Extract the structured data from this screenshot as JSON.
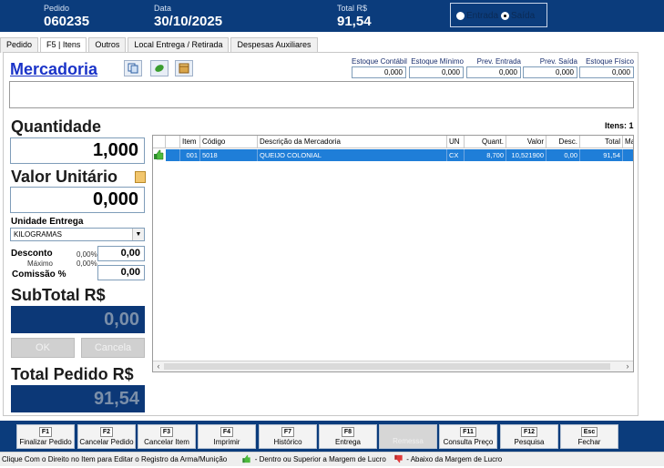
{
  "header": {
    "pedido_label": "Pedido",
    "pedido_value": "060235",
    "data_label": "Data",
    "data_value": "30/10/2025",
    "total_label": "Total R$",
    "total_value": "91,54",
    "entrada_label": "Entrada",
    "saida_label": "Saída",
    "selected": "Saída"
  },
  "tabs": [
    "Pedido",
    "F5 | Itens",
    "Outros",
    "Local Entrega  / Retirada",
    "Despesas Auxiliares"
  ],
  "active_tab": "F5 | Itens",
  "mercadoria": {
    "title": "Mercadoria",
    "icons": [
      "copy-icon",
      "leaf-icon",
      "box-icon"
    ]
  },
  "stock": [
    {
      "label": "Estoque Contábil",
      "value": "0,000"
    },
    {
      "label": "Estoque Mínimo",
      "value": "0,000"
    },
    {
      "label": "Prev. Entrada",
      "value": "0,000"
    },
    {
      "label": "Prev. Saída",
      "value": "0,000"
    },
    {
      "label": "Estoque Físico",
      "value": "0,000"
    }
  ],
  "form": {
    "quantidade_label": "Quantidade",
    "quantidade_value": "1,000",
    "valor_unitario_label": "Valor Unitário",
    "valor_unitario_value": "0,000",
    "unidade_entrega_label": "Unidade Entrega",
    "unidade_entrega_value": "KILOGRAMAS",
    "desconto_label": "Desconto",
    "desconto_pct": "0,00%",
    "desconto_value": "0,00",
    "maximo_label": "Máximo",
    "maximo_pct": "0,00%",
    "comissao_label": "Comissão %",
    "comissao_value": "0,00",
    "subtotal_label": "SubTotal R$",
    "subtotal_value": "0,00",
    "ok_label": "OK",
    "cancela_label": "Cancela",
    "total_pedido_label": "Total Pedido R$",
    "total_pedido_value": "91,54"
  },
  "grid": {
    "items_count": "Itens: 1",
    "columns": [
      "Item",
      "Código",
      "Descrição da Mercadoria",
      "UN",
      "Quant.",
      "Valor",
      "Desc.",
      "Total",
      "Ma"
    ],
    "rows": [
      {
        "item": "001",
        "codigo": "5018",
        "descricao": "QUEIJO COLONIAL",
        "un": "CX",
        "quant": "8,700",
        "valor": "10,521900",
        "desc": "0,00",
        "total": "91,54",
        "ma": ""
      }
    ],
    "row_status_icon": "thumbs-up-icon"
  },
  "footer": [
    {
      "key": "F1",
      "label": "Finalizar Pedido",
      "enabled": true
    },
    {
      "key": "F2",
      "label": "Cancelar Pedido",
      "enabled": true
    },
    {
      "key": "F3",
      "label": "Cancelar Item",
      "enabled": true
    },
    {
      "key": "F4",
      "label": "Imprimir",
      "enabled": true
    },
    {
      "key": "F7",
      "label": "Histórico",
      "enabled": true
    },
    {
      "key": "F8",
      "label": "Entrega",
      "enabled": true
    },
    {
      "key": "",
      "label": "Remessa",
      "enabled": false
    },
    {
      "key": "F11",
      "label": "Consulta Preço",
      "enabled": true
    },
    {
      "key": "F12",
      "label": "Pesquisa",
      "enabled": true
    },
    {
      "key": "Esc",
      "label": "Fechar",
      "enabled": true
    }
  ],
  "status": {
    "hint": "Clique Com o Direito no Item para Editar o Registro da Arma/Munição",
    "legend_up": "- Dentro ou Superior a Margem de Lucro",
    "legend_down": "- Abaixo da Margem de Lucro"
  },
  "colors": {
    "header_bg": "#0b3c7c",
    "selected_row": "#1f7ed8",
    "title_blue": "#1a33c8"
  }
}
